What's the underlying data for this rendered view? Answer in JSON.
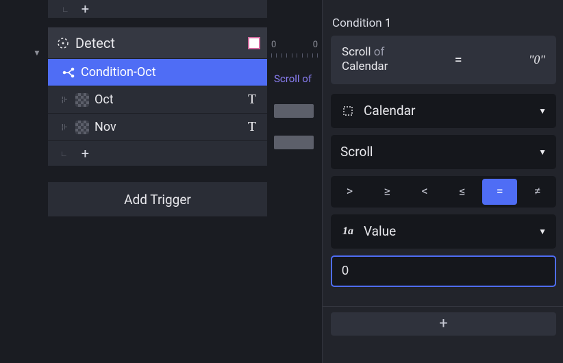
{
  "tree": {
    "detect_label": "Detect",
    "condition_label": "Condition-Oct",
    "rows": [
      {
        "label": "Oct"
      },
      {
        "label": "Nov"
      }
    ],
    "add_trigger_label": "Add Trigger",
    "plus": "+"
  },
  "timeline": {
    "start": "0",
    "end": "0",
    "track_label": "Scroll of"
  },
  "panel": {
    "title_prefix": "Condition",
    "title_num": "1",
    "summary": {
      "prop": "Scroll",
      "of": "of",
      "target": "Calendar",
      "op": "=",
      "value": "\"0\""
    },
    "target_select": "Calendar",
    "property_select": "Scroll",
    "operators": [
      ">",
      "≥",
      "<",
      "≤",
      "=",
      "≠"
    ],
    "operator_active_index": 4,
    "value_mode_label": "Value",
    "value_mode_prefix": "1a",
    "value_input": "0",
    "add_plus": "+"
  }
}
